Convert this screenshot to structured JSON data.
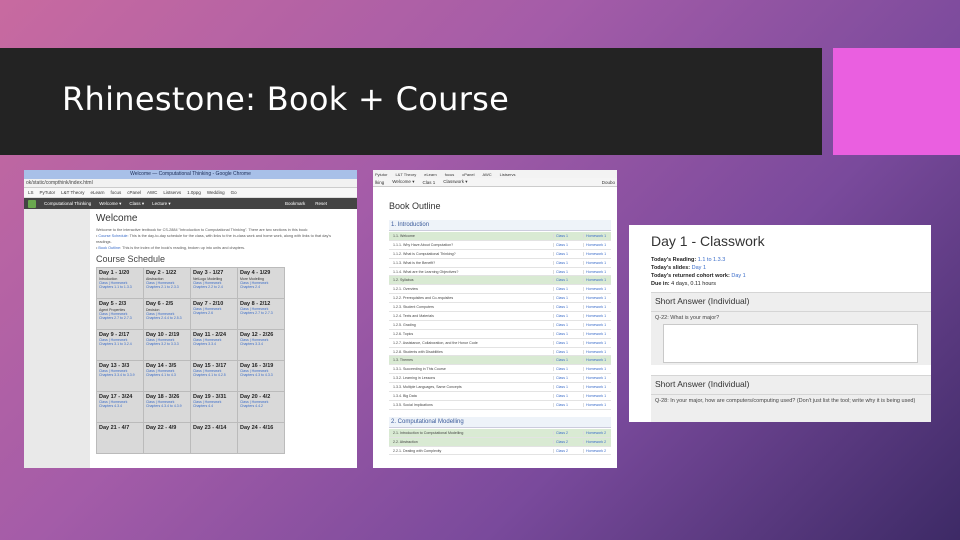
{
  "slide": {
    "title": "Rhinestone: Book + Course",
    "colors": {
      "title_bar": "#232323",
      "accent": "#ea5fe0"
    }
  },
  "browser_shot": {
    "window_title": "Welcome — Computational Thinking - Google Chrome",
    "address": "ok/static/compthink/index.html",
    "bookmarks": [
      "LS",
      "PyTutor",
      "L&T Theory",
      "eLearn",
      "focus",
      "cPanel",
      "AWC",
      "Listservs",
      "1.0ppg",
      "Wedding",
      "Go"
    ],
    "nav": {
      "brand": "Computational Thinking",
      "items": [
        "Welcome ▾",
        "Class ▾",
        "Lecture ▾"
      ],
      "right": [
        "Bookmark",
        "Reset"
      ]
    },
    "welcome_heading": "Welcome",
    "intro_line1": "Welcome to the interactive textbook for CS-2884 \"Introduction to Computational Thinking\". There are two sections in this book:",
    "intro_bullet1_link": "Course Schedule",
    "intro_bullet1_text": ": This is the day-to-day schedule for the class, with links to the in-class work and home work, along with links to that day's readings.",
    "intro_bullet2_link": "Book Outline",
    "intro_bullet2_text": ": This is the index of the book's reading, broken up into units and chapters.",
    "schedule_heading": "Course Schedule",
    "days": [
      {
        "d": "Day 1 - 1/20",
        "t": "Introduction",
        "c": "Class | Homework\nChapters 1.1 to 1.3.3"
      },
      {
        "d": "Day 2 - 1/22",
        "t": "Abstraction",
        "c": "Class | Homework\nChapters 2.1 to 2.3.3"
      },
      {
        "d": "Day 3 - 1/27",
        "t": "NetLogo Modelling",
        "c": "Class | Homework\nChapters 2.2 to 2.4"
      },
      {
        "d": "Day 4 - 1/29",
        "t": "More Modelling",
        "c": "Class | Homework\nChapters 2.4"
      },
      {
        "d": "Day 5 - 2/3",
        "t": "Agent Properties",
        "c": "Class | Homework\nChapters 2.7 to 2.7.3"
      },
      {
        "d": "Day 6 - 2/5",
        "t": "Decision",
        "c": "Class | Homework\nChapters 2.4.4 to 2.5.3"
      },
      {
        "d": "Day 7 - 2/10",
        "t": "",
        "c": "Class | Homework\nChapters 2.6"
      },
      {
        "d": "Day 8 - 2/12",
        "t": "",
        "c": "Class | Homework\nChapters 2.7 to 2.7.3"
      },
      {
        "d": "Day 9 - 2/17",
        "t": "",
        "c": "Class | Homework\nChapters 3.1 to 3.2.4"
      },
      {
        "d": "Day 10 - 2/19",
        "t": "",
        "c": "Class | Homework\nChapters 3.2 to 3.3.3"
      },
      {
        "d": "Day 11 - 2/24",
        "t": "",
        "c": "Class | Homework\nChapters 3.3.4"
      },
      {
        "d": "Day 12 - 2/26",
        "t": "",
        "c": "Class | Homework\nChapters 3.3.4"
      },
      {
        "d": "Day 13 - 3/3",
        "t": "",
        "c": "Class | Homework\nChapters 3.3.4 to 3.3.9"
      },
      {
        "d": "Day 14 - 3/5",
        "t": "",
        "c": "Class | Homework\nChapters 4.1 to 4.3"
      },
      {
        "d": "Day 15 - 3/17",
        "t": "",
        "c": "Class | Homework\nChapters 4.1 to 4.2.5"
      },
      {
        "d": "Day 16 - 3/19",
        "t": "",
        "c": "Class | Homework\nChapters 4.3 to 4.3.3"
      },
      {
        "d": "Day 17 - 3/24",
        "t": "",
        "c": "Class | Homework\nChapters 4.3.4"
      },
      {
        "d": "Day 18 - 3/26",
        "t": "",
        "c": "Class | Homework\nChapters 4.3.4 to 4.3.9"
      },
      {
        "d": "Day 19 - 3/31",
        "t": "",
        "c": "Class | Homework\nChapters 4.4"
      },
      {
        "d": "Day 20 - 4/2",
        "t": "",
        "c": "Class | Homework\nChapters 4.4.2"
      },
      {
        "d": "Day 21 - 4/7",
        "t": "",
        "c": ""
      },
      {
        "d": "Day 22 - 4/9",
        "t": "",
        "c": ""
      },
      {
        "d": "Day 23 - 4/14",
        "t": "",
        "c": ""
      },
      {
        "d": "Day 24 - 4/16",
        "t": "",
        "c": ""
      }
    ]
  },
  "outline_shot": {
    "bookmarks": [
      "Pyiutor",
      "L&T Theory",
      "eLearn",
      "focus",
      "cPanel",
      "AWC",
      "Listservs"
    ],
    "nav": {
      "left": "lking",
      "items": [
        "Welcome ▾",
        "Clas 1",
        "Classwork ▾"
      ],
      "right": "Doubo"
    },
    "heading": "Book Outline",
    "section1": "1. Introduction",
    "rows1": [
      {
        "n": "1.1. Welcome",
        "c": "Class 1",
        "h": "Homework 1",
        "hl": true
      },
      {
        "n": "1.1.1. Why Have About Computation?",
        "c": "Class 1",
        "h": "Homework 1",
        "hl": false
      },
      {
        "n": "1.1.2. What is Computational Thinking?",
        "c": "Class 1",
        "h": "Homework 1",
        "hl": false
      },
      {
        "n": "1.1.3. What is the Benefit?",
        "c": "Class 1",
        "h": "Homework 1",
        "hl": false
      },
      {
        "n": "1.1.4. What are the Learning Objectives?",
        "c": "Class 1",
        "h": "Homework 1",
        "hl": false
      },
      {
        "n": "1.2. Syllabus",
        "c": "Class 1",
        "h": "Homework 1",
        "hl": true
      },
      {
        "n": "1.2.1. Overview",
        "c": "Class 1",
        "h": "Homework 1",
        "hl": false
      },
      {
        "n": "1.2.2. Prerequisites and Co-requisites",
        "c": "Class 1",
        "h": "Homework 1",
        "hl": false
      },
      {
        "n": "1.2.3. Student Computers",
        "c": "Class 1",
        "h": "Homework 1",
        "hl": false
      },
      {
        "n": "1.2.4. Texts and Materials",
        "c": "Class 1",
        "h": "Homework 1",
        "hl": false
      },
      {
        "n": "1.2.5. Grading",
        "c": "Class 1",
        "h": "Homework 1",
        "hl": false
      },
      {
        "n": "1.2.6. Topics",
        "c": "Class 1",
        "h": "Homework 1",
        "hl": false
      },
      {
        "n": "1.2.7. Assistance, Collaboration, and the Honor Code",
        "c": "Class 1",
        "h": "Homework 1",
        "hl": false
      },
      {
        "n": "1.2.8. Students with Disabilities",
        "c": "Class 1",
        "h": "Homework 1",
        "hl": false
      },
      {
        "n": "1.3. Themes",
        "c": "Class 1",
        "h": "Homework 1",
        "hl": true
      },
      {
        "n": "1.3.1. Succeeding in This Course",
        "c": "Class 1",
        "h": "Homework 1",
        "hl": false
      },
      {
        "n": "1.3.2. Learning in Lessons",
        "c": "Class 1",
        "h": "Homework 1",
        "hl": false
      },
      {
        "n": "1.3.3. Multiple Languages, Same Concepts",
        "c": "Class 1",
        "h": "Homework 1",
        "hl": false
      },
      {
        "n": "1.3.4. Big Data",
        "c": "Class 1",
        "h": "Homework 1",
        "hl": false
      },
      {
        "n": "1.3.5. Social Implications",
        "c": "Class 1",
        "h": "Homework 1",
        "hl": false
      }
    ],
    "section2": "2. Computational Modelling",
    "rows2": [
      {
        "n": "2.1. Introduction to Computational Modelling",
        "c": "Class 2",
        "h": "Homework 2",
        "hl": true
      },
      {
        "n": "2.2. Abstraction",
        "c": "Class 2",
        "h": "Homework 2",
        "hl": true
      },
      {
        "n": "2.2.1. Dealing with Complexity",
        "c": "Class 2",
        "h": "Homework 2",
        "hl": false
      }
    ]
  },
  "classwork_shot": {
    "title": "Day 1 - Classwork",
    "reading_label": "Today's Reading:",
    "reading_value": "1.1 to 1.3.3",
    "slides_label": "Today's slides:",
    "slides_value": "Day 1",
    "cohort_label": "Today's returned cohort work:",
    "cohort_value": "Day 1",
    "due_label": "Due in:",
    "due_value": "4 days, 0.11 hours",
    "card1_head": "Short Answer (Individual)",
    "q1": "Q-22: What is your major?",
    "card2_head": "Short Answer (Individual)",
    "q2": "Q-28: In your major, how are computers/computing used? (Don't just list the tool; write why it is being used)"
  }
}
